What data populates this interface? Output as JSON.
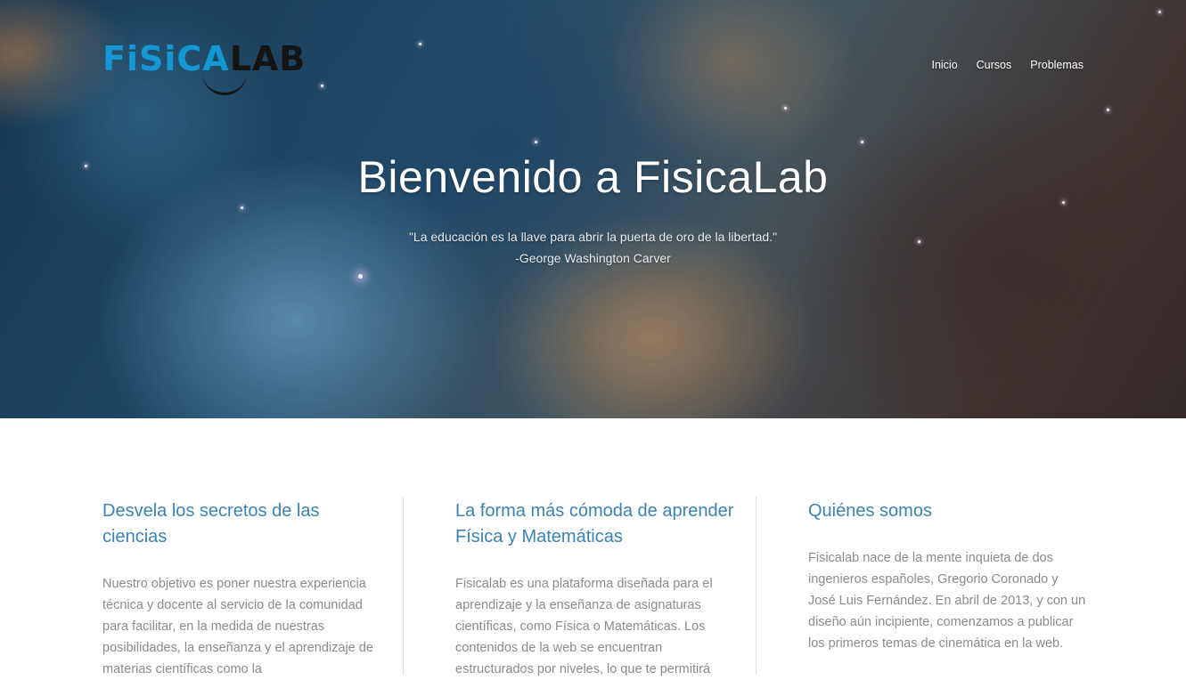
{
  "brand": {
    "logo_part1": "FiSiCA",
    "logo_part2": "LAB"
  },
  "nav": {
    "items": [
      "Inicio",
      "Cursos",
      "Problemas"
    ]
  },
  "hero": {
    "title": "Bienvenido a FisicaLab",
    "quote": "\"La educación es la llave para abrir la puerta de oro de la libertad.\"",
    "author": "-George Washington Carver"
  },
  "columns": [
    {
      "title": "Desvela los secretos de las ciencias",
      "text": "Nuestro objetivo es poner nuestra experiencia técnica y docente al servicio de la comunidad para facilitar, en la medida de nuestras posibilidades, la enseñanza y el aprendizaje de materias científicas como la"
    },
    {
      "title": "La forma más cómoda de aprender Física y Matemáticas",
      "text": "Fisicalab es una plataforma diseñada para el aprendizaje y la enseñanza de asignaturas científicas, como Física o Matemáticas. Los contenidos de la web se encuentran estructurados por niveles, lo que te permitirá"
    },
    {
      "title": "Quiénes somos",
      "text": "Fisicalab nace de la mente inquieta de dos ingenieros españoles, Gregorio Coronado y José Luis Fernández. En abril de 2013, y con un diseño aún incipiente, comenzamos a publicar los primeros temas de cinemática en la web."
    }
  ],
  "colors": {
    "brand_blue": "#1597d3",
    "heading_blue": "#3a83b6",
    "body_gray": "#8b8b8b"
  }
}
